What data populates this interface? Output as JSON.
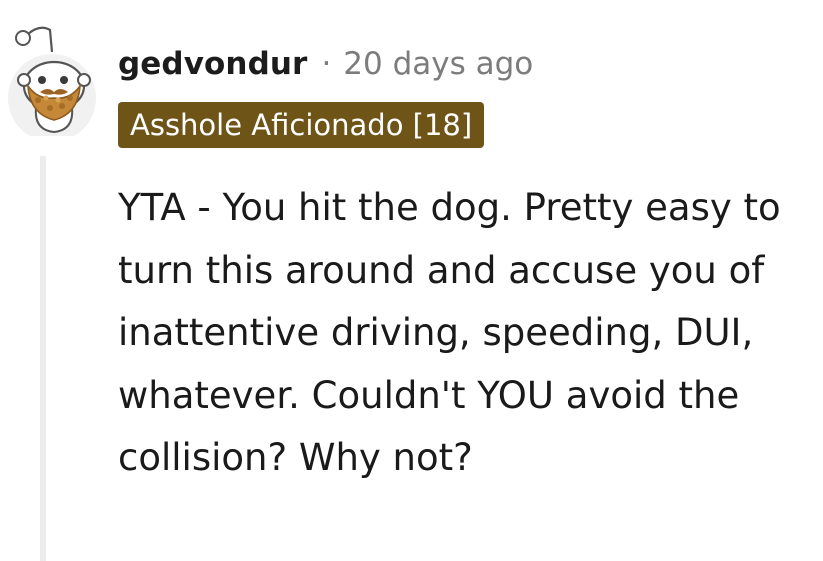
{
  "comment": {
    "author": "gedvondur",
    "separator": "·",
    "timestamp": "20 days ago",
    "flair": "Asshole Aficionado [18]",
    "body": "YTA - You hit the dog. Pretty easy to turn this around and accuse you of inattentive driving, speeding, DUI, whatever. Couldn't YOU avoid the collision? Why not?",
    "avatar_icon": "snoo-avatar-icon",
    "flair_color": "#6e5417",
    "thread_line_color": "#ededed"
  }
}
